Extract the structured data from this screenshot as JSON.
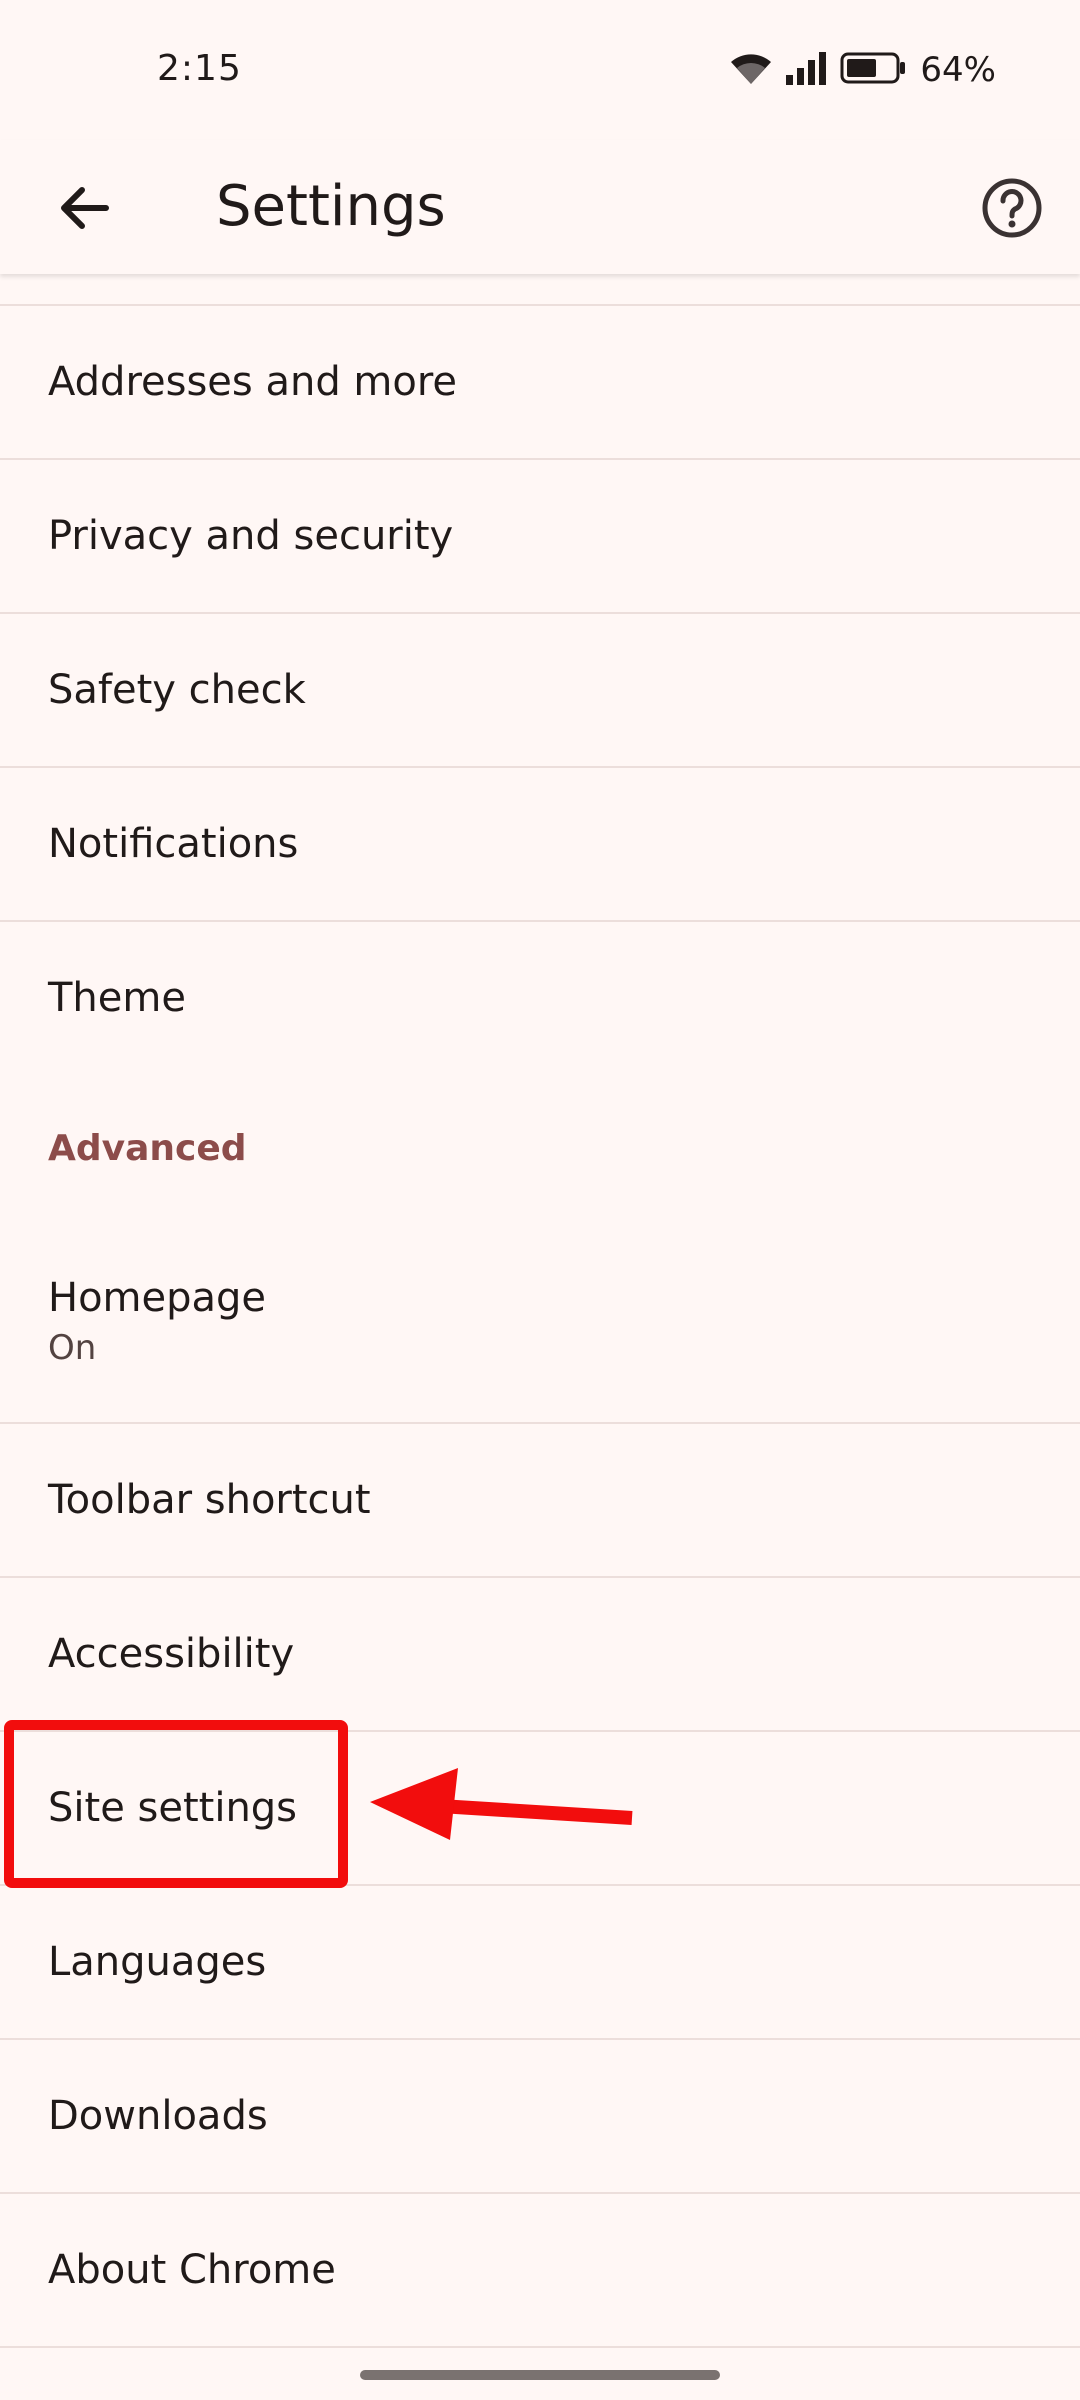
{
  "status_bar": {
    "time": "2:15",
    "battery_percent": "64%",
    "battery_level": 0.64
  },
  "app_bar": {
    "title": "Settings",
    "back_icon": "arrow-back-icon",
    "help_icon": "help-circle-icon"
  },
  "settings": {
    "items": [
      {
        "label": "Addresses and more"
      },
      {
        "label": "Privacy and security"
      },
      {
        "label": "Safety check"
      },
      {
        "label": "Notifications"
      },
      {
        "label": "Theme"
      }
    ],
    "advanced_header": "Advanced",
    "advanced_items": [
      {
        "label": "Homepage",
        "sublabel": "On"
      },
      {
        "label": "Toolbar shortcut"
      },
      {
        "label": "Accessibility"
      },
      {
        "label": "Site settings"
      },
      {
        "label": "Languages"
      },
      {
        "label": "Downloads"
      },
      {
        "label": "About Chrome"
      }
    ]
  },
  "colors": {
    "background": "#fff7f5",
    "section_header": "#8c4c4a",
    "annotation": "#f20d0d"
  }
}
